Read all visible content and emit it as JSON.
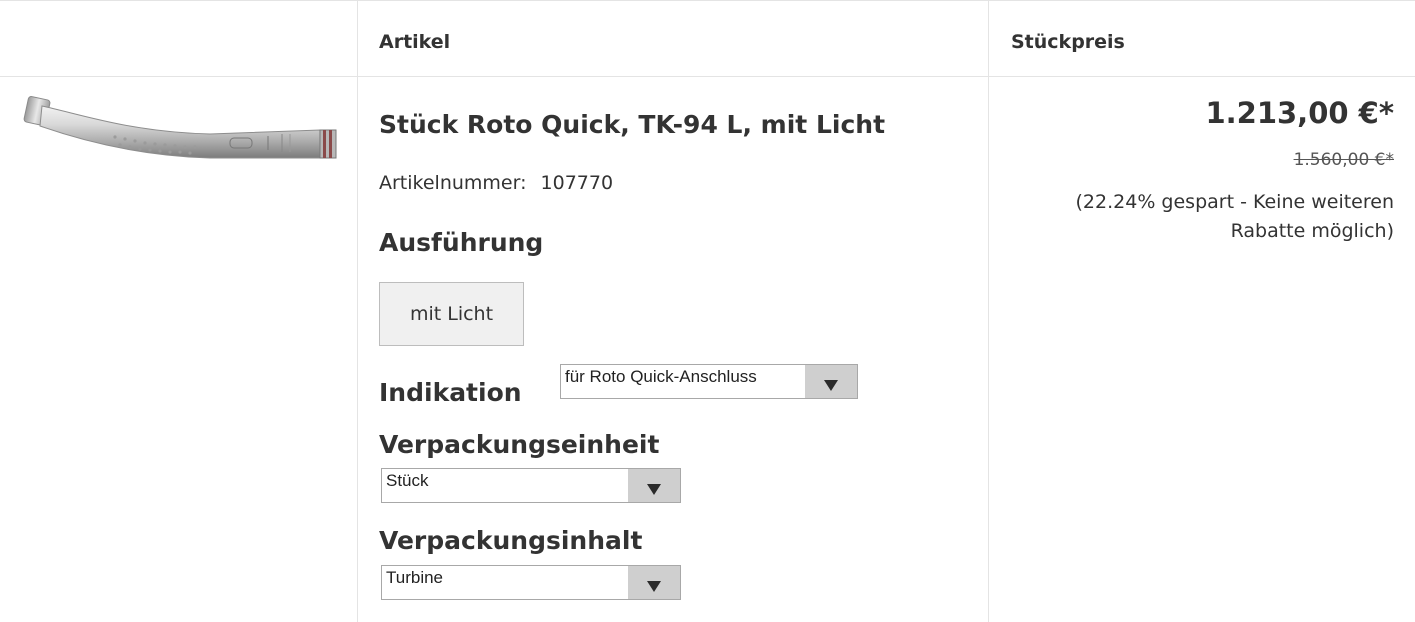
{
  "header": {
    "col_article": "Artikel",
    "col_unit_price": "Stückpreis"
  },
  "product": {
    "image_icon": "dental-turbine-handpiece-icon",
    "title": "Stück Roto Quick, TK-94 L, mit Licht",
    "article_number_label": "Artikelnummer:",
    "article_number": "107770",
    "variant_section_label": "Ausführung",
    "variant_option": "mit Licht",
    "indication_label": "Indikation",
    "indication_value": "für Roto Quick-Anschluss",
    "packaging_unit_label": "Verpackungseinheit",
    "packaging_unit_value": "Stück",
    "packaging_content_label": "Verpackungsinhalt",
    "packaging_content_value": "Turbine"
  },
  "price": {
    "current": "1.213,00 €*",
    "original": "1.560,00 €*",
    "savings": "(22.24% gespart - Keine weiteren Rabatte möglich)"
  },
  "colors": {
    "border": "#e4e4e4",
    "text": "#333333",
    "button_bg": "#f0f0f0",
    "select_arrow_bg": "#cfcfcf"
  }
}
